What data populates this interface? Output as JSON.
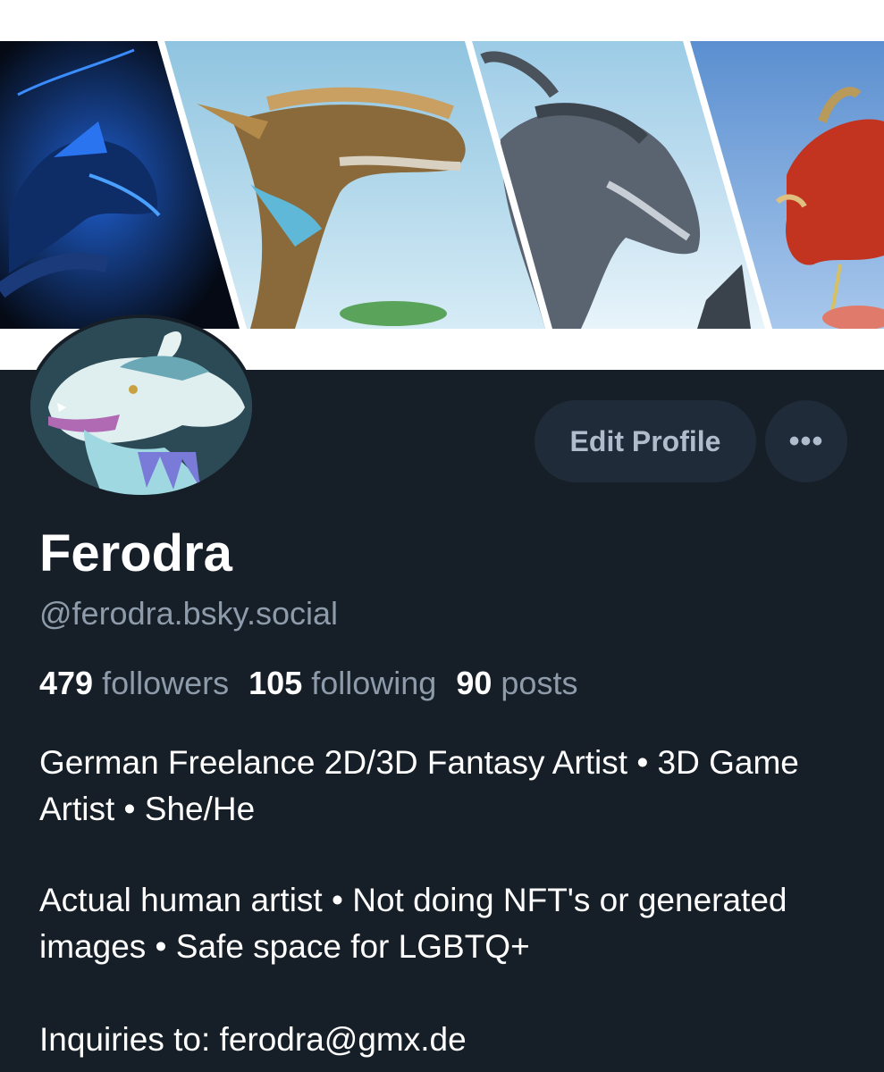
{
  "banner": {
    "panels": [
      "blue-dragon",
      "golden-dragon",
      "grey-dragon",
      "red-dragon"
    ]
  },
  "avatar": {
    "icon": "dragon-avatar"
  },
  "actions": {
    "edit_label": "Edit Profile",
    "more_label": "•••"
  },
  "profile": {
    "display_name": "Ferodra",
    "handle": "@ferodra.bsky.social"
  },
  "stats": {
    "followers_count": "479",
    "followers_label": "followers",
    "following_count": "105",
    "following_label": "following",
    "posts_count": "90",
    "posts_label": "posts"
  },
  "bio": {
    "line1": "German Freelance 2D/3D Fantasy Artist •  3D Game Artist • She/He",
    "line2": "Actual human artist • Not doing NFT's or generated images • Safe space for LGBTQ+",
    "line3": "Inquiries to: ferodra@gmx.de"
  },
  "colors": {
    "background": "#161e27",
    "button_bg": "#1f2b38",
    "muted_text": "#8d9baa"
  }
}
